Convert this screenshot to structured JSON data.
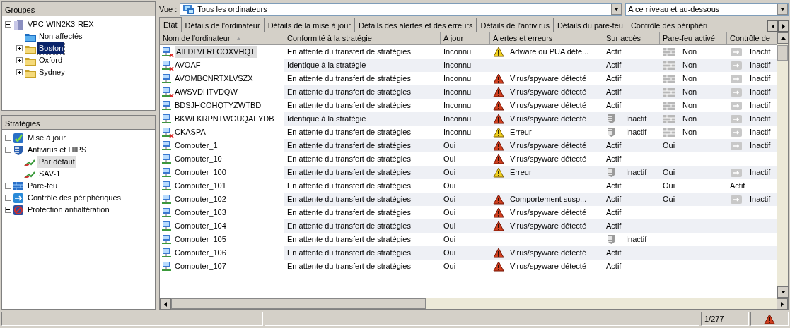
{
  "groups": {
    "title": "Groupes",
    "tree": [
      {
        "label": "VPC-WIN2K3-REX",
        "kind": "server",
        "expanded": true,
        "selected": false,
        "children": [
          {
            "label": "Non affectés",
            "kind": "folder-blue",
            "selected": false
          },
          {
            "label": "Boston",
            "kind": "folder",
            "expanded": false,
            "selected": true
          },
          {
            "label": "Oxford",
            "kind": "folder",
            "expanded": false,
            "selected": false
          },
          {
            "label": "Sydney",
            "kind": "folder",
            "expanded": false,
            "selected": false
          }
        ]
      }
    ]
  },
  "policies": {
    "title": "Stratégies",
    "tree": [
      {
        "label": "Mise à jour",
        "kind": "update",
        "expanded": false,
        "selected": false
      },
      {
        "label": "Antivirus et HIPS",
        "kind": "shield",
        "expanded": true,
        "selected": false,
        "children": [
          {
            "label": "Par défaut",
            "kind": "policy",
            "selected": true
          },
          {
            "label": "SAV-1",
            "kind": "policy",
            "selected": false
          }
        ]
      },
      {
        "label": "Pare-feu",
        "kind": "firewall",
        "expanded": false,
        "selected": false
      },
      {
        "label": "Contrôle des périphériques",
        "kind": "device",
        "expanded": false,
        "selected": false
      },
      {
        "label": "Protection antialtération",
        "kind": "tamper",
        "expanded": false,
        "selected": false
      }
    ]
  },
  "view": {
    "label": "Vue :",
    "value": "Tous les ordinateurs",
    "scope": "A ce niveau et au-dessous"
  },
  "tabs": [
    {
      "label": "Etat",
      "selected": true
    },
    {
      "label": "Détails de l'ordinateur",
      "selected": false
    },
    {
      "label": "Détails de la mise à jour",
      "selected": false
    },
    {
      "label": "Détails des alertes et des erreurs",
      "selected": false
    },
    {
      "label": "Détails de l'antivirus",
      "selected": false
    },
    {
      "label": "Détails du pare-feu",
      "selected": false
    },
    {
      "label": "Contrôle des périphéri",
      "selected": false
    }
  ],
  "table": {
    "columns": [
      "Nom de l'ordinateur",
      "Conformité à la stratégie",
      "A jour",
      "Alertes et erreurs",
      "Sur accès",
      "Pare-feu activé",
      "Contrôle de"
    ],
    "rows": [
      {
        "name": "AILDLVLRLCOXVHQT",
        "disconnected": true,
        "selected": true,
        "compliance": "En attente du transfert de stratégies",
        "up_to_date": "Inconnu",
        "alert": {
          "kind": "warning",
          "text": "Adware ou PUA déte..."
        },
        "on_access": {
          "text": "Actif",
          "icon": false
        },
        "firewall": {
          "text": "Non",
          "icon": true
        },
        "device": {
          "text": "Inactif",
          "icon": true
        }
      },
      {
        "name": "AVOAF",
        "disconnected": true,
        "selected": false,
        "compliance": "Identique à la stratégie",
        "up_to_date": "Inconnu",
        "alert": {
          "kind": "none"
        },
        "on_access": {
          "text": "Actif",
          "icon": false
        },
        "firewall": {
          "text": "Non",
          "icon": true
        },
        "device": {
          "text": "Inactif",
          "icon": true
        }
      },
      {
        "name": "AVOMBCNRTXLVSZX",
        "disconnected": false,
        "selected": false,
        "compliance": "En attente du transfert de stratégies",
        "up_to_date": "Inconnu",
        "alert": {
          "kind": "error",
          "text": "Virus/spyware détecté"
        },
        "on_access": {
          "text": "Actif",
          "icon": false
        },
        "firewall": {
          "text": "Non",
          "icon": true
        },
        "device": {
          "text": "Inactif",
          "icon": true
        }
      },
      {
        "name": "AWSVDHTVDQW",
        "disconnected": true,
        "selected": false,
        "compliance": "En attente du transfert de stratégies",
        "up_to_date": "Inconnu",
        "alert": {
          "kind": "error",
          "text": "Virus/spyware détecté"
        },
        "on_access": {
          "text": "Actif",
          "icon": false
        },
        "firewall": {
          "text": "Non",
          "icon": true
        },
        "device": {
          "text": "Inactif",
          "icon": true
        }
      },
      {
        "name": "BDSJHCOHQTYZWTBD",
        "disconnected": false,
        "selected": false,
        "compliance": "En attente du transfert de stratégies",
        "up_to_date": "Inconnu",
        "alert": {
          "kind": "error",
          "text": "Virus/spyware détecté"
        },
        "on_access": {
          "text": "Actif",
          "icon": false
        },
        "firewall": {
          "text": "Non",
          "icon": true
        },
        "device": {
          "text": "Inactif",
          "icon": true
        }
      },
      {
        "name": "BKWLKRPNTWGUQAFYDB",
        "disconnected": false,
        "selected": false,
        "compliance": "Identique à la stratégie",
        "up_to_date": "Inconnu",
        "alert": {
          "kind": "error",
          "text": "Virus/spyware détecté"
        },
        "on_access": {
          "text": "Inactif",
          "icon": true
        },
        "firewall": {
          "text": "Non",
          "icon": true
        },
        "device": {
          "text": "Inactif",
          "icon": true
        }
      },
      {
        "name": "CKASPA",
        "disconnected": true,
        "selected": false,
        "compliance": "En attente du transfert de stratégies",
        "up_to_date": "Inconnu",
        "alert": {
          "kind": "warning",
          "text": "Erreur"
        },
        "on_access": {
          "text": "Inactif",
          "icon": true
        },
        "firewall": {
          "text": "Non",
          "icon": true
        },
        "device": {
          "text": "Inactif",
          "icon": true
        }
      },
      {
        "name": "Computer_1",
        "disconnected": false,
        "selected": false,
        "compliance": "En attente du transfert de stratégies",
        "up_to_date": "Oui",
        "alert": {
          "kind": "error",
          "text": "Virus/spyware détecté"
        },
        "on_access": {
          "text": "Actif",
          "icon": false
        },
        "firewall": {
          "text": "Oui",
          "icon": false
        },
        "device": {
          "text": "Inactif",
          "icon": true
        }
      },
      {
        "name": "Computer_10",
        "disconnected": false,
        "selected": false,
        "compliance": "En attente du transfert de stratégies",
        "up_to_date": "Oui",
        "alert": {
          "kind": "error",
          "text": "Virus/spyware détecté"
        },
        "on_access": {
          "text": "Actif",
          "icon": false
        }
      },
      {
        "name": "Computer_100",
        "disconnected": false,
        "selected": false,
        "compliance": "En attente du transfert de stratégies",
        "up_to_date": "Oui",
        "alert": {
          "kind": "warning",
          "text": "Erreur"
        },
        "on_access": {
          "text": "Inactif",
          "icon": true
        },
        "firewall": {
          "text": "Oui",
          "icon": false
        },
        "device": {
          "text": "Inactif",
          "icon": true
        }
      },
      {
        "name": "Computer_101",
        "disconnected": false,
        "selected": false,
        "compliance": "En attente du transfert de stratégies",
        "up_to_date": "Oui",
        "alert": {
          "kind": "none"
        },
        "on_access": {
          "text": "Actif",
          "icon": false
        },
        "firewall": {
          "text": "Oui",
          "icon": false
        },
        "device": {
          "text": "Actif",
          "icon": false
        }
      },
      {
        "name": "Computer_102",
        "disconnected": false,
        "selected": false,
        "compliance": "En attente du transfert de stratégies",
        "up_to_date": "Oui",
        "alert": {
          "kind": "error",
          "text": "Comportement susp..."
        },
        "on_access": {
          "text": "Actif",
          "icon": false
        },
        "firewall": {
          "text": "Oui",
          "icon": false
        },
        "device": {
          "text": "Inactif",
          "icon": true
        }
      },
      {
        "name": "Computer_103",
        "disconnected": false,
        "selected": false,
        "compliance": "En attente du transfert de stratégies",
        "up_to_date": "Oui",
        "alert": {
          "kind": "error",
          "text": "Virus/spyware détecté"
        },
        "on_access": {
          "text": "Actif",
          "icon": false
        }
      },
      {
        "name": "Computer_104",
        "disconnected": false,
        "selected": false,
        "compliance": "En attente du transfert de stratégies",
        "up_to_date": "Oui",
        "alert": {
          "kind": "error",
          "text": "Virus/spyware détecté"
        },
        "on_access": {
          "text": "Actif",
          "icon": false
        }
      },
      {
        "name": "Computer_105",
        "disconnected": false,
        "selected": false,
        "compliance": "En attente du transfert de stratégies",
        "up_to_date": "Oui",
        "alert": {
          "kind": "none"
        },
        "on_access": {
          "text": "Inactif",
          "icon": true
        }
      },
      {
        "name": "Computer_106",
        "disconnected": false,
        "selected": false,
        "compliance": "En attente du transfert de stratégies",
        "up_to_date": "Oui",
        "alert": {
          "kind": "error",
          "text": "Virus/spyware détecté"
        },
        "on_access": {
          "text": "Actif",
          "icon": false
        }
      },
      {
        "name": "Computer_107",
        "disconnected": false,
        "selected": false,
        "compliance": "En attente du transfert de stratégies",
        "up_to_date": "Oui",
        "alert": {
          "kind": "error",
          "text": "Virus/spyware détecté"
        },
        "on_access": {
          "text": "Actif",
          "icon": false
        }
      }
    ]
  },
  "status_bar": {
    "count": "1/277",
    "alert": {
      "kind": "error"
    }
  }
}
